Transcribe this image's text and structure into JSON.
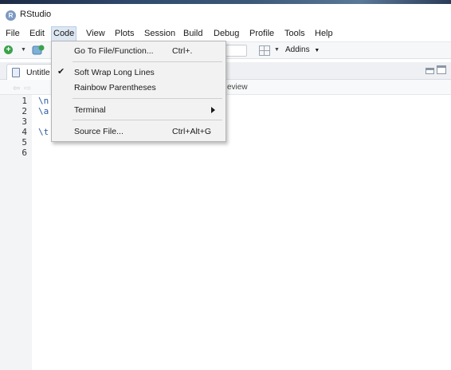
{
  "window": {
    "title": "RStudio",
    "logo_letter": "R"
  },
  "menubar": {
    "items": [
      "File",
      "Edit",
      "Code",
      "View",
      "Plots",
      "Session",
      "Build",
      "Debug",
      "Profile",
      "Tools",
      "Help"
    ],
    "active": "Code"
  },
  "toolbar": {
    "addins_label": "Addins"
  },
  "editor": {
    "tab_label": "Untitle",
    "preview_fragment": "eview",
    "line_numbers": [
      "1",
      "2",
      "3",
      "4",
      "5",
      "6"
    ],
    "code_lines": [
      "\\n",
      "\\a",
      "",
      "\\t",
      "",
      ""
    ]
  },
  "code_menu": {
    "items": [
      {
        "label": "Go To File/Function...",
        "shortcut": "Ctrl+.",
        "checked": false,
        "submenu": false
      },
      {
        "label": "Soft Wrap Long Lines",
        "shortcut": "",
        "checked": true,
        "submenu": false
      },
      {
        "label": "Rainbow Parentheses",
        "shortcut": "",
        "checked": false,
        "submenu": false
      },
      {
        "label": "Terminal",
        "shortcut": "",
        "checked": false,
        "submenu": true
      },
      {
        "label": "Source File...",
        "shortcut": "Ctrl+Alt+G",
        "checked": false,
        "submenu": false
      }
    ],
    "check_glyph": "✔"
  },
  "colors": {
    "menu_highlight": "#dde7f2",
    "new_icon": "#3aa34a",
    "code_text": "#2c5aa0"
  }
}
